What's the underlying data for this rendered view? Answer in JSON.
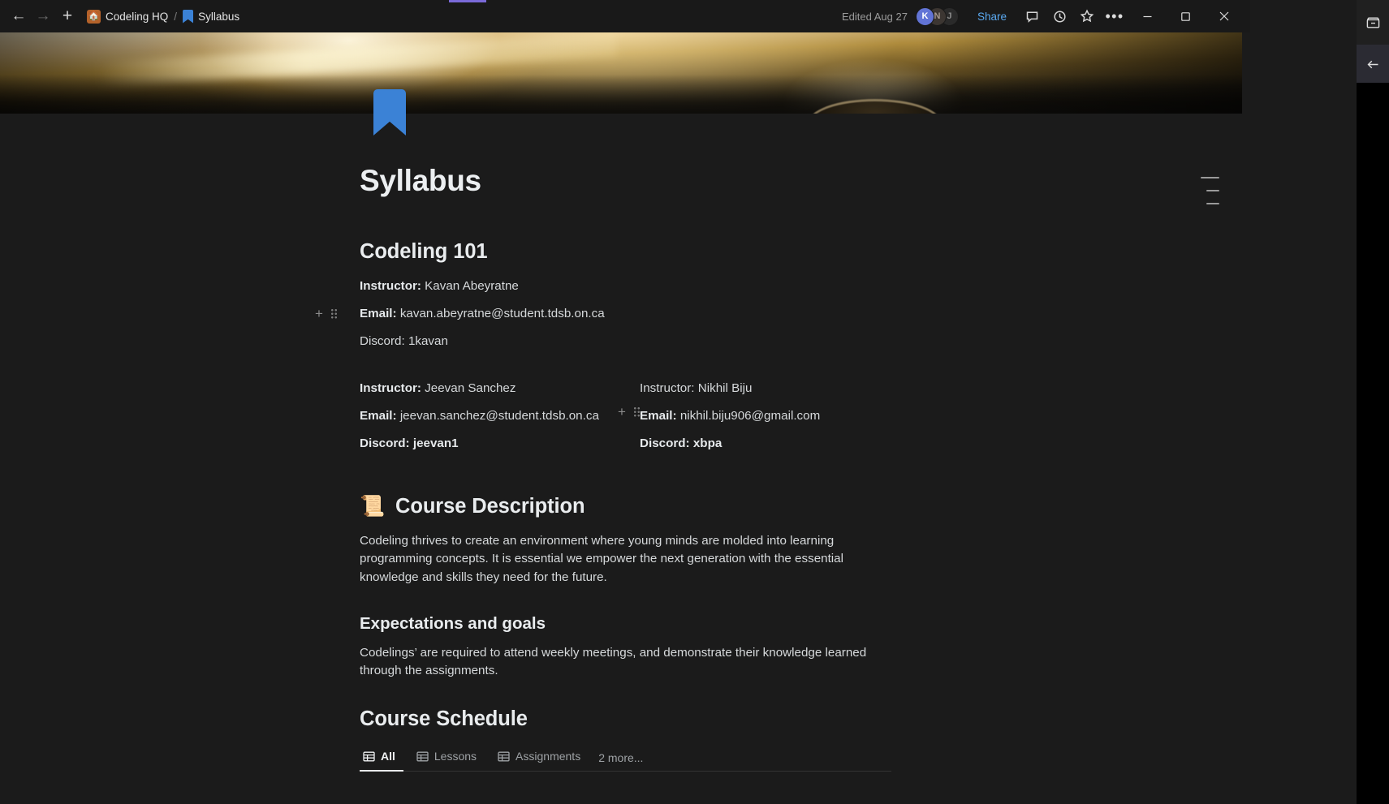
{
  "window": {
    "nav": {
      "back": "←",
      "forward": "→",
      "new_tab": "+"
    },
    "breadcrumb": [
      {
        "label": "Codeling HQ",
        "icon": "home-icon"
      },
      {
        "label": "Syllabus",
        "icon": "bookmark-icon"
      }
    ],
    "separator": "/",
    "edited": "Edited Aug 27",
    "avatars": [
      {
        "initial": "K",
        "color": "#6274d6"
      },
      {
        "initial": "N",
        "color": "#3c3632"
      },
      {
        "initial": "J",
        "color": "#2a2a2a"
      }
    ],
    "share_label": "Share",
    "toolbar_icons": [
      "comment-icon",
      "history-icon",
      "star-icon",
      "more-icon"
    ],
    "window_controls": [
      "minimize",
      "maximize",
      "close"
    ]
  },
  "page": {
    "icon": "bookmark-icon",
    "title": "Syllabus",
    "course": {
      "heading": "Codeling 101",
      "primary_instructor": {
        "instructor_label": "Instructor:",
        "instructor_name": "Kavan Abeyratne",
        "email_label": "Email:",
        "email": "kavan.abeyratne@student.tdsb.on.ca",
        "discord_label": "Discord:",
        "discord": "1kavan"
      },
      "instructors": [
        {
          "instructor_label": "Instructor:",
          "instructor_name": "Jeevan Sanchez",
          "email_label": "Email:",
          "email": "jeevan.sanchez@student.tdsb.on.ca",
          "discord_label": "Discord:",
          "discord": "jeevan1"
        },
        {
          "instructor_label": "Instructor:",
          "instructor_name": "Nikhil Biju",
          "email_label": "Email:",
          "email": "nikhil.biju906@gmail.com",
          "discord_label": "Discord:",
          "discord": "xbpa"
        }
      ]
    },
    "course_description": {
      "emoji": "📜",
      "heading": "Course Description",
      "body": "Codeling thrives to create an environment where young minds are molded into learning programming concepts. It is essential we empower the next generation with the essential knowledge and skills they need for the future."
    },
    "expectations": {
      "heading": "Expectations and goals",
      "body": "Codelings’ are required to attend weekly meetings, and demonstrate their knowledge learned through the assignments."
    },
    "course_schedule": {
      "heading": "Course Schedule",
      "tabs": [
        {
          "label": "All",
          "icon": "table-icon",
          "active": true
        },
        {
          "label": "Lessons",
          "icon": "table-icon",
          "active": false
        },
        {
          "label": "Assignments",
          "icon": "table-icon",
          "active": false
        }
      ],
      "more_label": "2 more..."
    }
  },
  "colors": {
    "accent_blue": "#3b82d6",
    "share_blue": "#5aa9f0",
    "background": "#1b1b1b",
    "avatar_primary": "#6274d6"
  }
}
